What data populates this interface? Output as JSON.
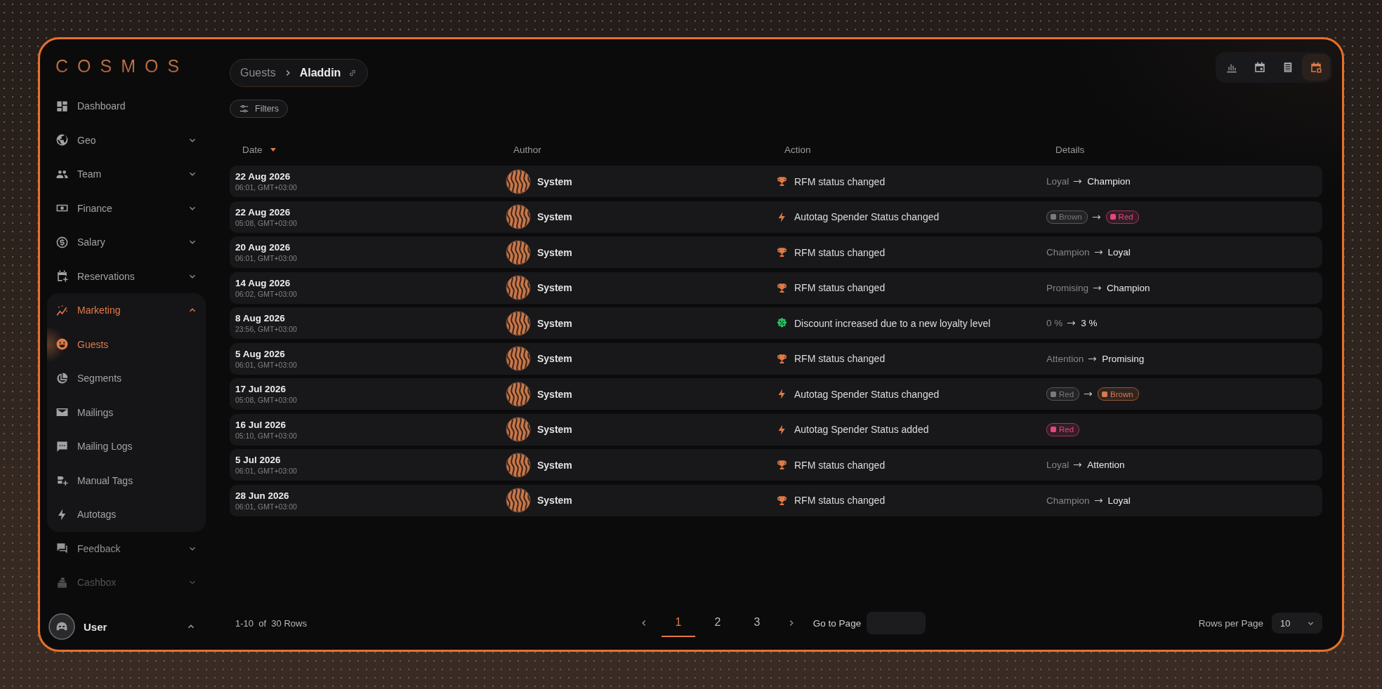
{
  "brand": "COSMOS",
  "sidebar": {
    "items": [
      {
        "kind": "dashboard",
        "label": "Dashboard",
        "selected": false
      },
      {
        "kind": "globe",
        "label": "Geo",
        "expanded": false,
        "selected": false
      },
      {
        "kind": "team",
        "label": "Team",
        "expanded": false,
        "selected": false
      },
      {
        "kind": "finance",
        "label": "Finance",
        "expanded": false,
        "selected": false
      },
      {
        "kind": "salary",
        "label": "Salary",
        "expanded": false,
        "selected": false
      },
      {
        "kind": "reservations",
        "label": "Reservations",
        "expanded": false,
        "selected": false
      },
      {
        "kind": "marketing",
        "label": "Marketing",
        "expanded": true,
        "selected": true,
        "children": [
          {
            "kind": "guests",
            "label": "Guests",
            "selected": true
          },
          {
            "kind": "segments",
            "label": "Segments",
            "selected": false
          },
          {
            "kind": "mailings",
            "label": "Mailings",
            "selected": false
          },
          {
            "kind": "logs",
            "label": "Mailing Logs",
            "selected": false
          },
          {
            "kind": "tags",
            "label": "Manual Tags",
            "selected": false
          },
          {
            "kind": "bolt",
            "label": "Autotags",
            "selected": false
          }
        ]
      },
      {
        "kind": "feedback",
        "label": "Feedback",
        "expanded": false,
        "selected": false
      },
      {
        "kind": "cashbox",
        "label": "Cashbox",
        "expanded": false,
        "selected": false
      }
    ],
    "user": {
      "name": "User"
    }
  },
  "breadcrumb": {
    "parent": "Guests",
    "current": "Aladdin"
  },
  "views": [
    {
      "kind": "chart",
      "selected": false
    },
    {
      "kind": "calendar",
      "selected": false
    },
    {
      "kind": "list",
      "selected": false
    },
    {
      "kind": "calendar-tag",
      "selected": true
    }
  ],
  "filters_button": "Filters",
  "table": {
    "columns": [
      "Date",
      "Author",
      "Action",
      "Details"
    ],
    "rows": [
      {
        "date": "22 Aug 2026",
        "time": "06:01, GMT+03:00",
        "author": "System",
        "kind": "trophy",
        "action": "RFM status changed",
        "details": {
          "kind": "text",
          "from": "Loyal",
          "to": "Champion"
        }
      },
      {
        "date": "22 Aug 2026",
        "time": "05:08, GMT+03:00",
        "author": "System",
        "kind": "bolt",
        "action": "Autotag Spender Status changed",
        "details": {
          "kind": "tags",
          "from": {
            "label": "Brown",
            "color": "#7a7a7e"
          },
          "to": {
            "label": "Red",
            "color": "#e8467e"
          }
        }
      },
      {
        "date": "20 Aug 2026",
        "time": "06:01, GMT+03:00",
        "author": "System",
        "kind": "trophy",
        "action": "RFM status changed",
        "details": {
          "kind": "text",
          "from": "Champion",
          "to": "Loyal"
        }
      },
      {
        "date": "14 Aug 2026",
        "time": "06:02, GMT+03:00",
        "author": "System",
        "kind": "trophy",
        "action": "RFM status changed",
        "details": {
          "kind": "text",
          "from": "Promising",
          "to": "Champion"
        }
      },
      {
        "date": "8 Aug 2026",
        "time": "23:56, GMT+03:00",
        "author": "System",
        "kind": "discount",
        "action": "Discount increased due to a new loyalty level",
        "details": {
          "kind": "text",
          "from": "0 %",
          "to": "3 %"
        }
      },
      {
        "date": "5 Aug 2026",
        "time": "06:01, GMT+03:00",
        "author": "System",
        "kind": "trophy",
        "action": "RFM status changed",
        "details": {
          "kind": "text",
          "from": "Attention",
          "to": "Promising"
        }
      },
      {
        "date": "17 Jul 2026",
        "time": "05:08, GMT+03:00",
        "author": "System",
        "kind": "bolt",
        "action": "Autotag Spender Status changed",
        "details": {
          "kind": "tags",
          "from": {
            "label": "Red",
            "color": "#7a7a7e"
          },
          "to": {
            "label": "Brown",
            "color": "#d9794a"
          }
        }
      },
      {
        "date": "16 Jul 2026",
        "time": "05:10, GMT+03:00",
        "author": "System",
        "kind": "bolt",
        "action": "Autotag Spender Status added",
        "details": {
          "kind": "tag",
          "to": {
            "label": "Red",
            "color": "#e8467e"
          }
        }
      },
      {
        "date": "5 Jul 2026",
        "time": "06:01, GMT+03:00",
        "author": "System",
        "kind": "trophy",
        "action": "RFM status changed",
        "details": {
          "kind": "text",
          "from": "Loyal",
          "to": "Attention"
        }
      },
      {
        "date": "28 Jun 2026",
        "time": "06:01, GMT+03:00",
        "author": "System",
        "kind": "trophy",
        "action": "RFM status changed",
        "details": {
          "kind": "text",
          "from": "Champion",
          "to": "Loyal"
        }
      }
    ]
  },
  "footer": {
    "range": "1-10  of  30 Rows",
    "pages": [
      {
        "label": "1",
        "selected": true
      },
      {
        "label": "2",
        "selected": false
      },
      {
        "label": "3",
        "selected": false
      }
    ],
    "goto_label": "Go to Page",
    "rows_per_page_label": "Rows per Page",
    "rows_per_page": "10"
  }
}
